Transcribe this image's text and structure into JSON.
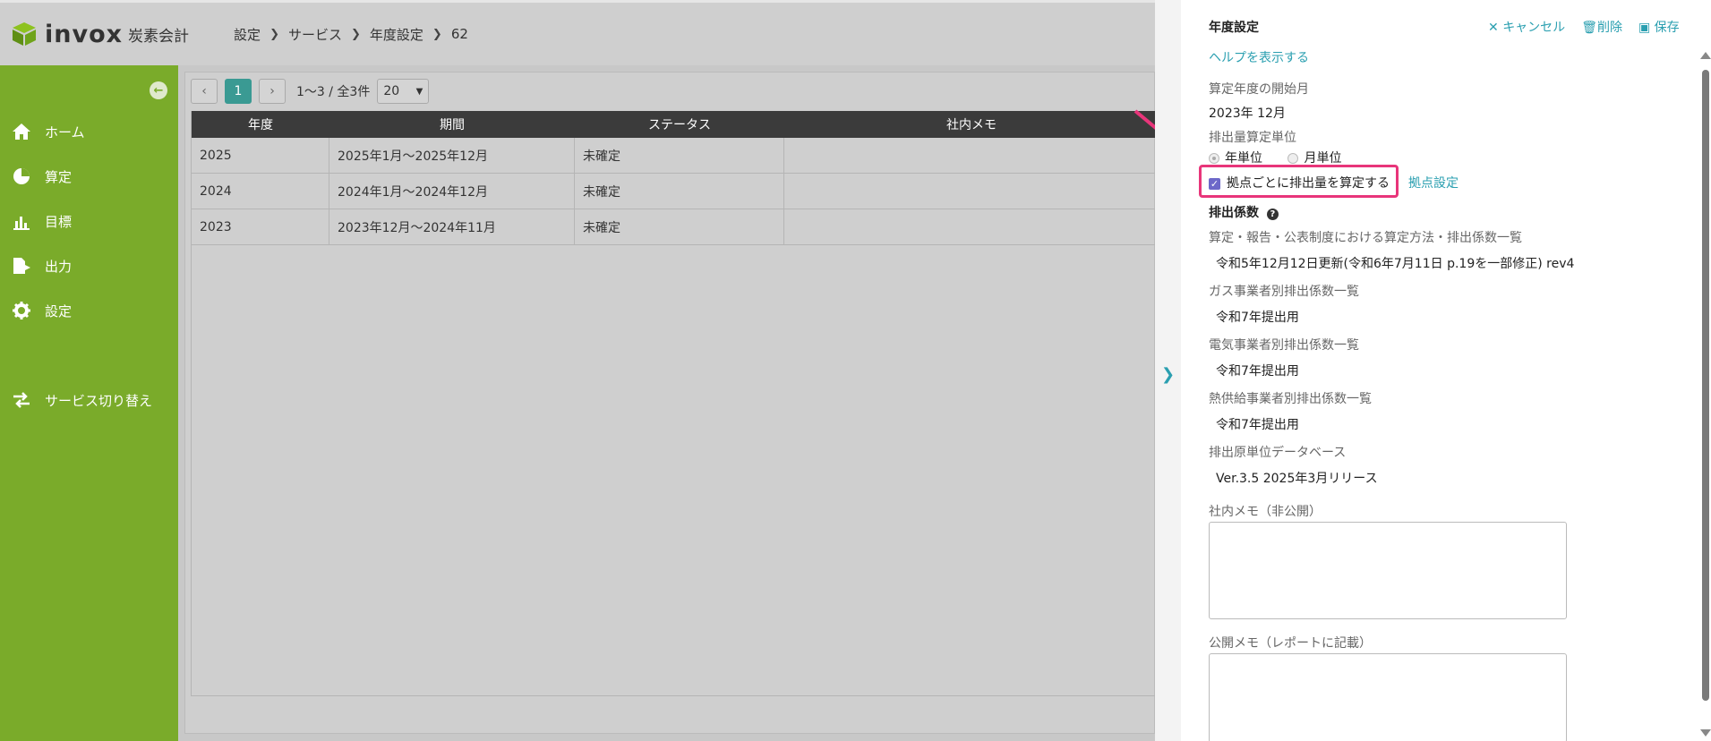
{
  "header": {
    "logo_text": "invox",
    "logo_sub": "炭素会計",
    "breadcrumb": [
      "設定",
      "サービス",
      "年度設定",
      "62"
    ]
  },
  "sidebar": {
    "items": [
      {
        "label": "ホーム",
        "icon": "home-icon"
      },
      {
        "label": "算定",
        "icon": "pie-chart-icon"
      },
      {
        "label": "目標",
        "icon": "bar-chart-icon"
      },
      {
        "label": "出力",
        "icon": "export-icon"
      },
      {
        "label": "設定",
        "icon": "gear-icon"
      },
      {
        "label": "サービス切り替え",
        "icon": "switch-icon"
      }
    ]
  },
  "pager": {
    "current_page": "1",
    "info": "1〜3 / 全3件",
    "per_page": "20"
  },
  "table": {
    "headers": [
      "年度",
      "期間",
      "ステータス",
      "社内メモ"
    ],
    "rows": [
      [
        "2025",
        "2025年1月〜2025年12月",
        "未確定",
        ""
      ],
      [
        "2024",
        "2024年1月〜2024年12月",
        "未確定",
        ""
      ],
      [
        "2023",
        "2023年12月〜2024年11月",
        "未確定",
        ""
      ]
    ]
  },
  "panel": {
    "title": "年度設定",
    "cancel": "キャンセル",
    "delete": "削除",
    "save": "保存",
    "help_link": "ヘルプを表示する",
    "start_month_label": "算定年度の開始月",
    "start_month_value": "2023年 12月",
    "unit_label": "排出量算定単位",
    "unit_year": "年単位",
    "unit_month": "月単位",
    "per_site_checkbox": "拠点ごとに排出量を算定する",
    "site_settings_link": "拠点設定",
    "factor_title": "排出係数",
    "factors": [
      {
        "label": "算定・報告・公表制度における算定方法・排出係数一覧",
        "value": "令和5年12月12日更新(令和6年7月11日 p.19を一部修正) rev4"
      },
      {
        "label": "ガス事業者別排出係数一覧",
        "value": "令和7年提出用"
      },
      {
        "label": "電気事業者別排出係数一覧",
        "value": "令和7年提出用"
      },
      {
        "label": "熱供給事業者別排出係数一覧",
        "value": "令和7年提出用"
      },
      {
        "label": "排出原単位データベース",
        "value": "Ver.3.5 2025年3月リリース"
      }
    ],
    "internal_memo_label": "社内メモ（非公開）",
    "public_memo_label": "公開メモ（レポートに記載）"
  },
  "colors": {
    "sidebar_green": "#7aab2a",
    "accent_teal": "#2a9fb0",
    "highlight_pink": "#e8357a"
  }
}
